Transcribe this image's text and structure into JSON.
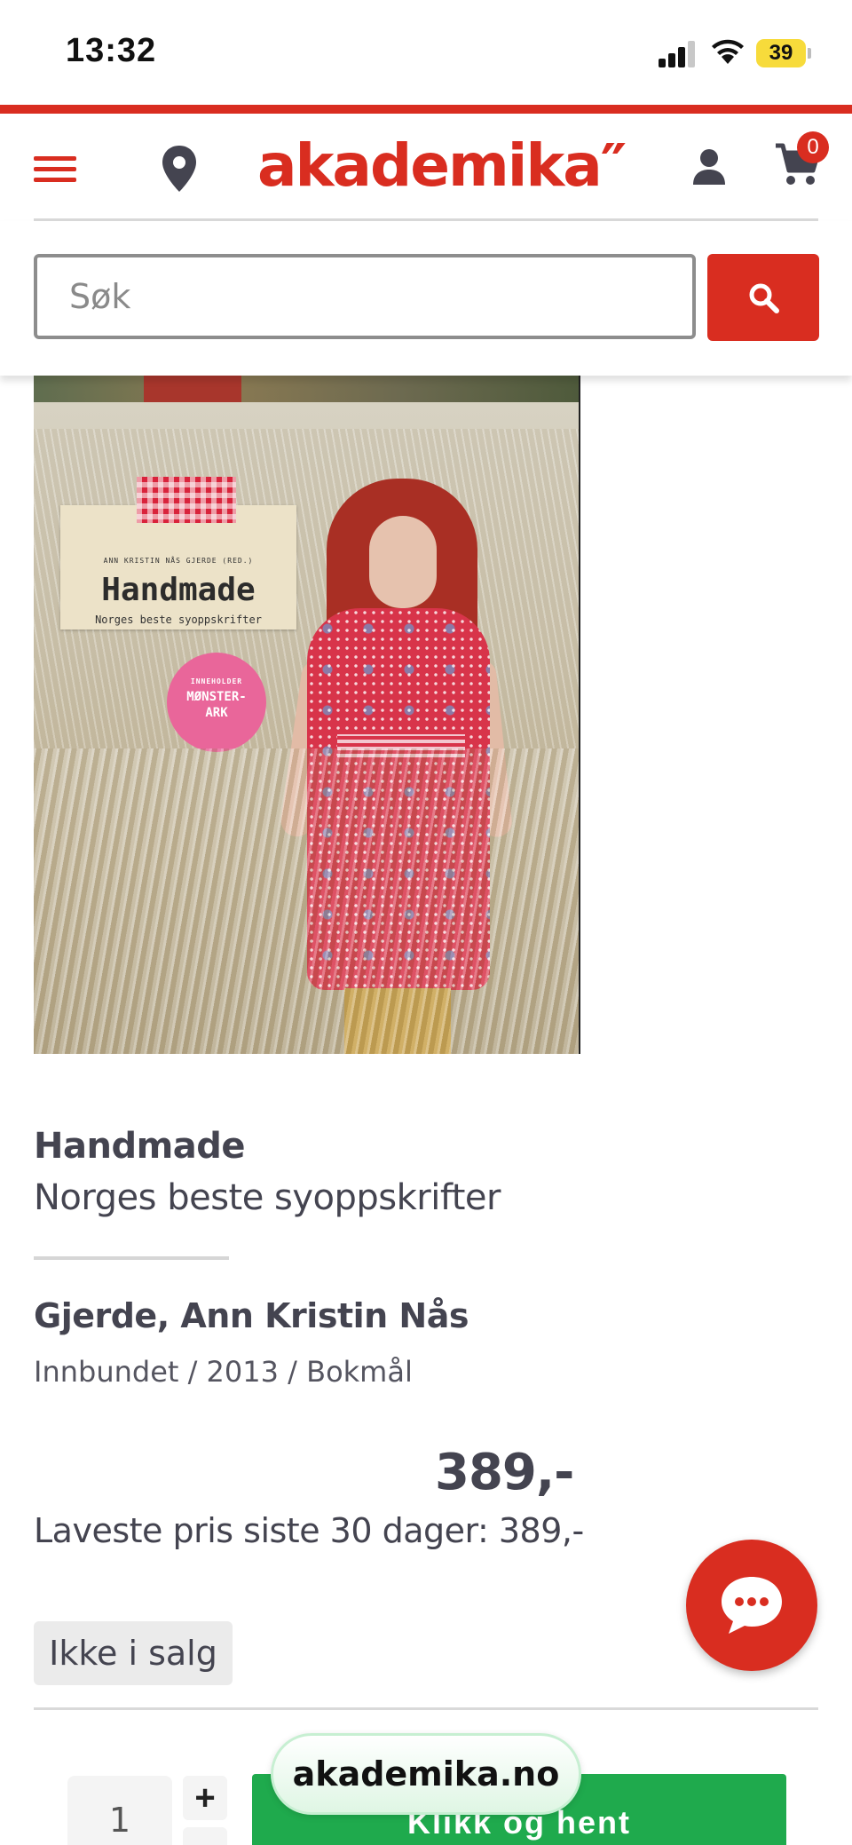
{
  "status_bar": {
    "time": "13:32",
    "battery": "39"
  },
  "header": {
    "logo": "akademika″",
    "cart_count": "0"
  },
  "search": {
    "placeholder": "Søk"
  },
  "cover": {
    "editor_line": "ANN KRISTIN NÅS GJERDE (RED.)",
    "title": "Handmade",
    "subtitle": "Norges beste syoppskrifter",
    "sticker_line1": "INNEHOLDER",
    "sticker_line2": "MØNSTER-",
    "sticker_line3": "ARK"
  },
  "product": {
    "title": "Handmade",
    "subtitle": "Norges beste syoppskrifter",
    "author": "Gjerde, Ann Kristin Nås",
    "meta": "Innbundet / 2013 / Bokmål",
    "price": "389,-",
    "lowest_price": "Laveste pris siste 30 dager: 389,-",
    "stock_status": "Ikke i salg"
  },
  "purchase": {
    "quantity": "1",
    "plus": "+",
    "minus": "-",
    "cta_label": "Klikk og hent"
  },
  "browser": {
    "site_label": "akademika.no"
  },
  "colors": {
    "brand_red": "#d92d20",
    "cta_green": "#1faa4d"
  },
  "icons": [
    "menu-icon",
    "location-pin-icon",
    "user-icon",
    "cart-icon",
    "search-icon",
    "chat-icon"
  ]
}
